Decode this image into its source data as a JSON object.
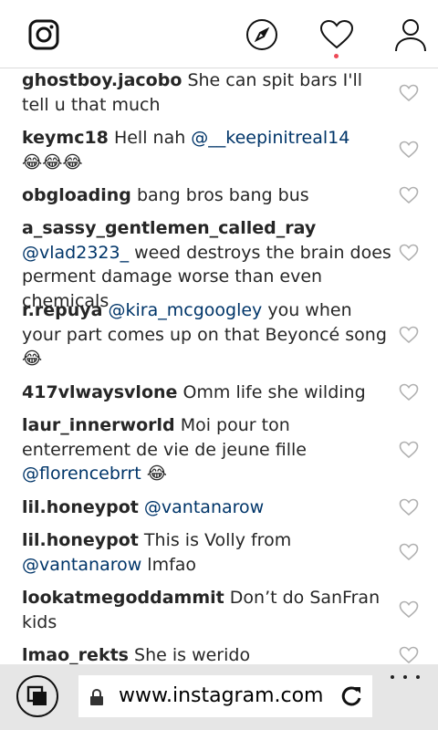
{
  "header": {
    "icons": [
      "instagram-logo-icon",
      "compass-icon",
      "heart-icon",
      "profile-icon"
    ],
    "notification_dot_color": "#ed4956"
  },
  "comments": [
    {
      "user": "ghostboy.jacobo",
      "mention": "",
      "text": "She can spit bars I'll tell u that much"
    },
    {
      "user": "keymc18",
      "mention": "",
      "text": "Hell nah ",
      "mention_inline": "@__keepinitreal14",
      "tail": "😂😂😂"
    },
    {
      "user": "obgloading",
      "mention": "",
      "text": "bang bros bang bus"
    },
    {
      "user": "a_sassy_gentlemen_called_ray",
      "mention": "@vlad2323_",
      "text": "weed destroys the brain does perment damage worse than even chemicals"
    },
    {
      "user": "r.repuya",
      "mention": "@kira_mcgoogley",
      "text": "you when your part comes up on that Beyoncé song 😂"
    },
    {
      "user": "417vlwaysvlone",
      "mention": "",
      "text": "Omm life she wilding"
    },
    {
      "user": "laur_innerworld",
      "mention": "",
      "text": "Moi pour ton enterrement de vie de jeune fille ",
      "mention_inline": "@florencebrrt",
      "tail": " 😂"
    },
    {
      "user": "lil.honeypot",
      "mention": "@vantanarow",
      "text": ""
    },
    {
      "user": "lil.honeypot",
      "mention": "",
      "text": "This is Volly from ",
      "mention_inline": "@vantanarow",
      "tail": " lmfao"
    },
    {
      "user": "lookatmegoddammit",
      "mention": "",
      "text": "Don’t do SanFran kids"
    },
    {
      "user": "lmao_rekts",
      "mention": "",
      "text": "She is werido"
    }
  ],
  "browser": {
    "url": "www.instagram.com/|",
    "icons": [
      "tabs-icon",
      "lock-icon",
      "refresh-icon",
      "more-icon"
    ]
  }
}
